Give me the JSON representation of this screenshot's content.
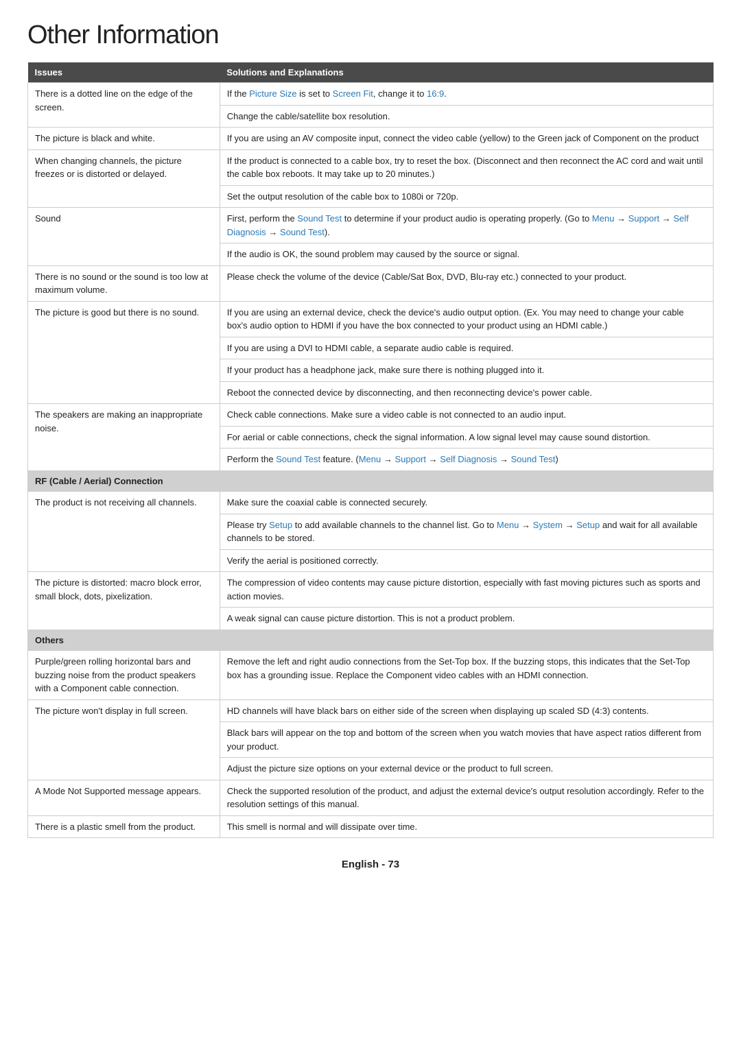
{
  "title": "Other Information",
  "footer": "English - 73",
  "table": {
    "headers": [
      "Issues",
      "Solutions and Explanations"
    ],
    "rows": [
      {
        "type": "data",
        "issue": "There is a dotted line on the edge of the screen.",
        "solution": "If the <a class=\"link-text\">Picture Size</a> is set to <a class=\"link-text\">Screen Fit</a>, change it to <a class=\"link-text\">16:9</a>.",
        "issue_rowspan": 2
      },
      {
        "type": "data-cont",
        "issue": "",
        "solution": "Change the cable/satellite box resolution."
      },
      {
        "type": "data",
        "issue": "The picture is black and white.",
        "solution": "If you are using an AV composite input, connect the video cable (yellow) to the Green jack of Component on the product"
      },
      {
        "type": "data",
        "issue": "When changing channels, the picture freezes or is distorted or delayed.",
        "solution": "If the product is connected to a cable box, try to reset the box. (Disconnect and then reconnect the AC cord and wait until the cable box reboots. It may take up to 20 minutes.)",
        "issue_rowspan": 2
      },
      {
        "type": "data-cont",
        "issue": "",
        "solution": "Set the output resolution of the cable box to 1080i or 720p."
      },
      {
        "type": "data",
        "issue": "Sound",
        "solution": "First, perform the <a class=\"link-text\">Sound Test</a> to determine if your product audio is operating properly. (Go to <a class=\"link-text\">Menu</a> → <a class=\"link-text\">Support</a> → <a class=\"link-text\">Self Diagnosis</a> → <a class=\"link-text\">Sound Test</a>).",
        "issue_rowspan": 2
      },
      {
        "type": "data-cont",
        "issue": "",
        "solution": "If the audio is OK, the sound problem may caused by the source or signal."
      },
      {
        "type": "data",
        "issue": "There is no sound or the sound is too low at maximum volume.",
        "solution": "Please check the volume of the device (Cable/Sat Box, DVD, Blu-ray etc.) connected to your product."
      },
      {
        "type": "data",
        "issue": "The picture is good but there is no sound.",
        "solution": "If you are using an external device, check the device's audio output option. (Ex. You may need to change your cable box's audio option to HDMI if you have the box connected to your product using an HDMI cable.)",
        "issue_rowspan": 5
      },
      {
        "type": "data-cont",
        "issue": "",
        "solution": "If you are using a DVI to HDMI cable, a separate audio cable is required."
      },
      {
        "type": "data-cont",
        "issue": "",
        "solution": "If your product has a headphone jack, make sure there is nothing plugged into it."
      },
      {
        "type": "data-cont",
        "issue": "",
        "solution": "Reboot the connected device by disconnecting, and then reconnecting device's power cable."
      },
      {
        "type": "data",
        "issue": "The speakers are making an inappropriate noise.",
        "solution": "Check cable connections. Make sure a video cable is not connected to an audio input.",
        "issue_rowspan": 3
      },
      {
        "type": "data-cont",
        "issue": "",
        "solution": "For aerial or cable connections, check the signal information. A low signal level may cause sound distortion."
      },
      {
        "type": "data-cont",
        "issue": "",
        "solution": "Perform the <a class=\"link-text\">Sound Test</a> feature. (<a class=\"link-text\">Menu</a> → <a class=\"link-text\">Support</a> → <a class=\"link-text\">Self Diagnosis</a> → <a class=\"link-text\">Sound Test</a>)"
      },
      {
        "type": "section",
        "label": "RF (Cable / Aerial) Connection"
      },
      {
        "type": "data",
        "issue": "The product is not receiving all channels.",
        "solution": "Make sure the coaxial cable is connected securely.",
        "issue_rowspan": 3
      },
      {
        "type": "data-cont",
        "issue": "",
        "solution": "Please try <a class=\"link-text\">Setup</a> to add available channels to the channel list. Go to <a class=\"link-text\">Menu</a> → <a class=\"link-text\">System</a> → <a class=\"link-text\">Setup</a> and wait for all available channels to be stored."
      },
      {
        "type": "data-cont",
        "issue": "",
        "solution": "Verify the aerial is positioned correctly."
      },
      {
        "type": "data",
        "issue": "The picture is distorted: macro block error, small block, dots, pixelization.",
        "solution": "The compression of video contents may cause picture distortion, especially with fast moving pictures such as sports and action movies.",
        "issue_rowspan": 2
      },
      {
        "type": "data-cont",
        "issue": "",
        "solution": "A weak signal can cause picture distortion. This is not a product problem."
      },
      {
        "type": "section",
        "label": "Others"
      },
      {
        "type": "data",
        "issue": "Purple/green rolling horizontal bars and buzzing noise from the product speakers with a Component cable connection.",
        "solution": "Remove the left and right audio connections from the Set-Top box. If the buzzing stops, this indicates that the Set-Top box has a grounding issue. Replace the Component video cables with an HDMI connection."
      },
      {
        "type": "data",
        "issue": "The picture won't display in full screen.",
        "solution": "HD channels will have black bars on either side of the screen when displaying up scaled SD (4:3) contents.",
        "issue_rowspan": 3
      },
      {
        "type": "data-cont",
        "issue": "",
        "solution": "Black bars will appear on the top and bottom of the screen when you watch movies that have aspect ratios different from your product."
      },
      {
        "type": "data-cont",
        "issue": "",
        "solution": "Adjust the picture size options on your external device or the product to full screen."
      },
      {
        "type": "data",
        "issue": "A Mode Not Supported message appears.",
        "solution": "Check the supported resolution of the product, and adjust the external device's output resolution accordingly. Refer to the resolution settings of this manual."
      },
      {
        "type": "data",
        "issue": "There is a plastic smell from the product.",
        "solution": "This smell is normal and will dissipate over time."
      }
    ]
  }
}
